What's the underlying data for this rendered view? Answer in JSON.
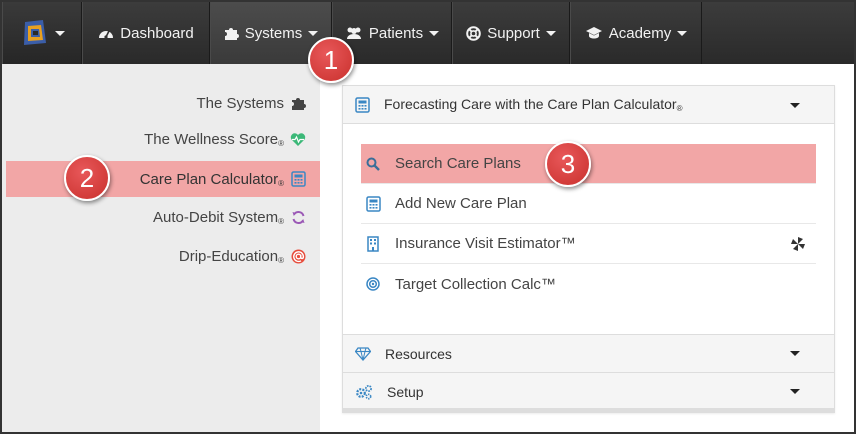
{
  "navbar": {
    "items": [
      {
        "label": "Dashboard",
        "icon": "tachometer-icon"
      },
      {
        "label": "Systems",
        "icon": "puzzle-icon"
      },
      {
        "label": "Patients",
        "icon": "users-icon"
      },
      {
        "label": "Support",
        "icon": "life-ring-icon"
      },
      {
        "label": "Academy",
        "icon": "graduation-cap-icon"
      }
    ]
  },
  "sidebar": {
    "items": [
      {
        "label": "The Systems",
        "reg": "",
        "icon": "puzzle-icon"
      },
      {
        "label": "The Wellness Score",
        "reg": "®",
        "icon": "heartbeat-icon"
      },
      {
        "label": "Care Plan Calculator",
        "reg": "®",
        "icon": "calculator-icon"
      },
      {
        "label": "Auto-Debit System",
        "reg": "®",
        "icon": "refresh-icon"
      },
      {
        "label": "Drip-Education",
        "reg": "®",
        "icon": "at-icon"
      }
    ]
  },
  "panel": {
    "title": "Forecasting Care with the Care Plan Calculator",
    "title_reg": "®",
    "items": [
      {
        "label": "Search Care Plans",
        "icon": "search-icon"
      },
      {
        "label": "Add New Care Plan",
        "icon": "calculator-icon"
      },
      {
        "label": "Insurance Visit Estimator™",
        "icon": "building-icon"
      },
      {
        "label": "Target Collection Calc™",
        "icon": "bullseye-icon"
      }
    ],
    "sections": [
      {
        "label": "Resources",
        "icon": "diamond-icon"
      },
      {
        "label": "Setup",
        "icon": "cogs-icon"
      }
    ]
  },
  "callouts": [
    "1",
    "2",
    "3"
  ],
  "colors": {
    "highlight": "#f2a6a6",
    "badge": "#d9433f",
    "navbar": "#333333",
    "heart": "#3cb878",
    "refresh": "#9b59b6",
    "at": "#e74c3c",
    "icon_blue": "#3a87c4"
  }
}
